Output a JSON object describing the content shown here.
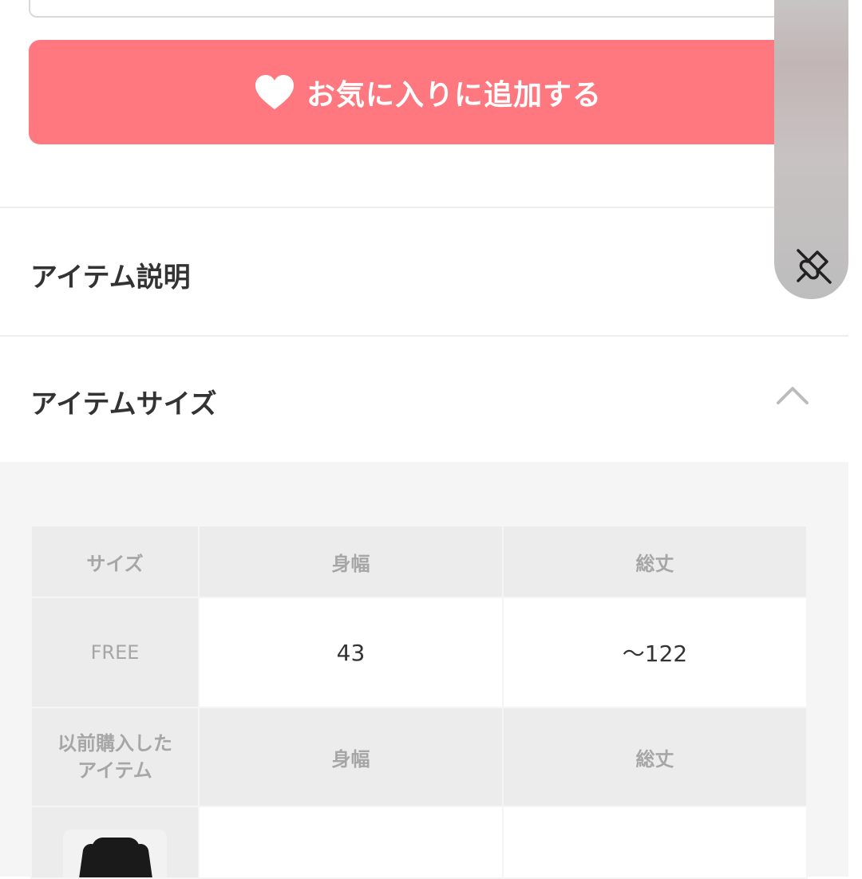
{
  "favorite_button": {
    "label": "お気に入りに追加する",
    "icon": "heart-icon"
  },
  "sections": {
    "description_title": "アイテム説明",
    "size_title": "アイテムサイズ"
  },
  "size_table": {
    "headers": [
      "サイズ",
      "身幅",
      "総丈"
    ],
    "rows": [
      {
        "size": "FREE",
        "width": "43",
        "length": "～122"
      }
    ],
    "previous": {
      "label": "以前購入したアイテム",
      "label_line1": "以前購入した",
      "label_line2": "アイテム",
      "headers": [
        "身幅",
        "総丈"
      ]
    }
  },
  "floating_panel": {
    "icon": "unpin-icon"
  },
  "colors": {
    "accent": "#ff7880",
    "panel_bg": "#f5f5f5",
    "header_cell": "#ececec",
    "muted_text": "#a6a6a6",
    "text": "#333333"
  }
}
